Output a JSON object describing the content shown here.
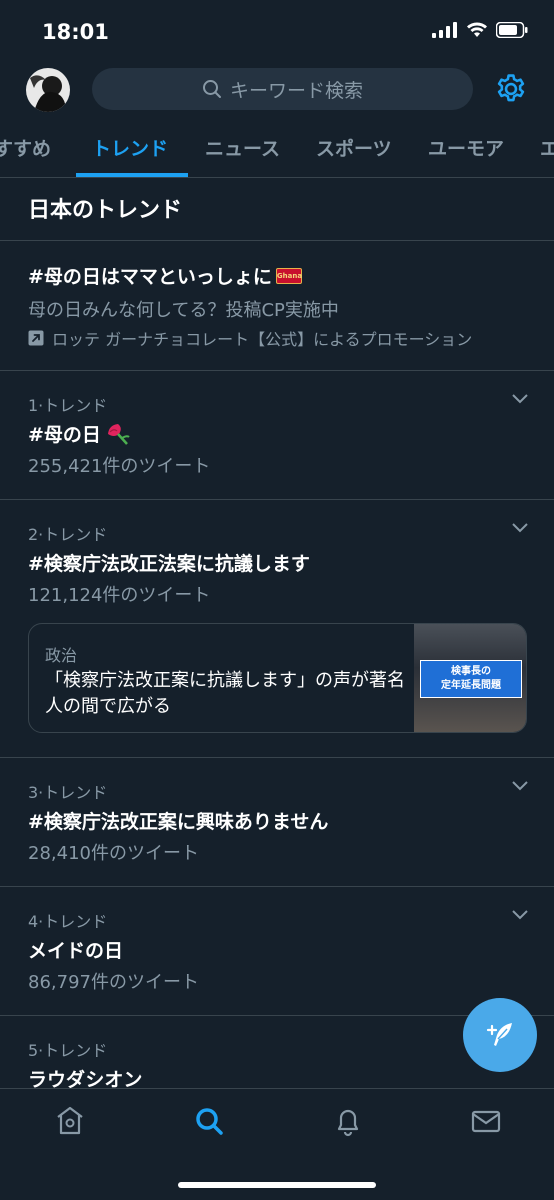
{
  "status": {
    "time": "18:01"
  },
  "search": {
    "placeholder": "キーワード検索"
  },
  "tabs": [
    {
      "label": "すすめ",
      "active": false
    },
    {
      "label": "トレンド",
      "active": true
    },
    {
      "label": "ニュース",
      "active": false
    },
    {
      "label": "スポーツ",
      "active": false
    },
    {
      "label": "ユーモア",
      "active": false
    },
    {
      "label": "エ",
      "active": false
    }
  ],
  "section_title": "日本のトレンド",
  "promoted": {
    "title": "#母の日はママといっしょに",
    "description": "母の日みんな何してる？投稿CP実施中",
    "promoted_by": "ロッテ ガーナチョコレート【公式】によるプロモーション",
    "badge_text": "Ghana"
  },
  "trends": [
    {
      "rank": "1·トレンド",
      "name": "#母の日",
      "count": "255,421件のツイート",
      "emoji": "carnation"
    },
    {
      "rank": "2·トレンド",
      "name": "#検察庁法改正法案に抗議します",
      "count": "121,124件のツイート",
      "news": {
        "category": "政治",
        "text": "「検察庁法改正案に抗議します」の声が著名人の間で広がる",
        "thumb_caption_1": "検事長の",
        "thumb_caption_2": "定年延長問題"
      }
    },
    {
      "rank": "3·トレンド",
      "name": "#検察庁法改正案に興味ありません",
      "count": "28,410件のツイート"
    },
    {
      "rank": "4·トレンド",
      "name": "メイドの日",
      "count": "86,797件のツイート"
    },
    {
      "rank": "5·トレンド",
      "name": "ラウダシオン",
      "count": ""
    }
  ],
  "colors": {
    "accent": "#1da1f2",
    "background": "#15202b",
    "muted": "#8899a6",
    "divider": "#38444d",
    "fab": "#4aa9e9"
  },
  "nav": [
    "home-icon",
    "search-icon",
    "bell-icon",
    "mail-icon"
  ]
}
